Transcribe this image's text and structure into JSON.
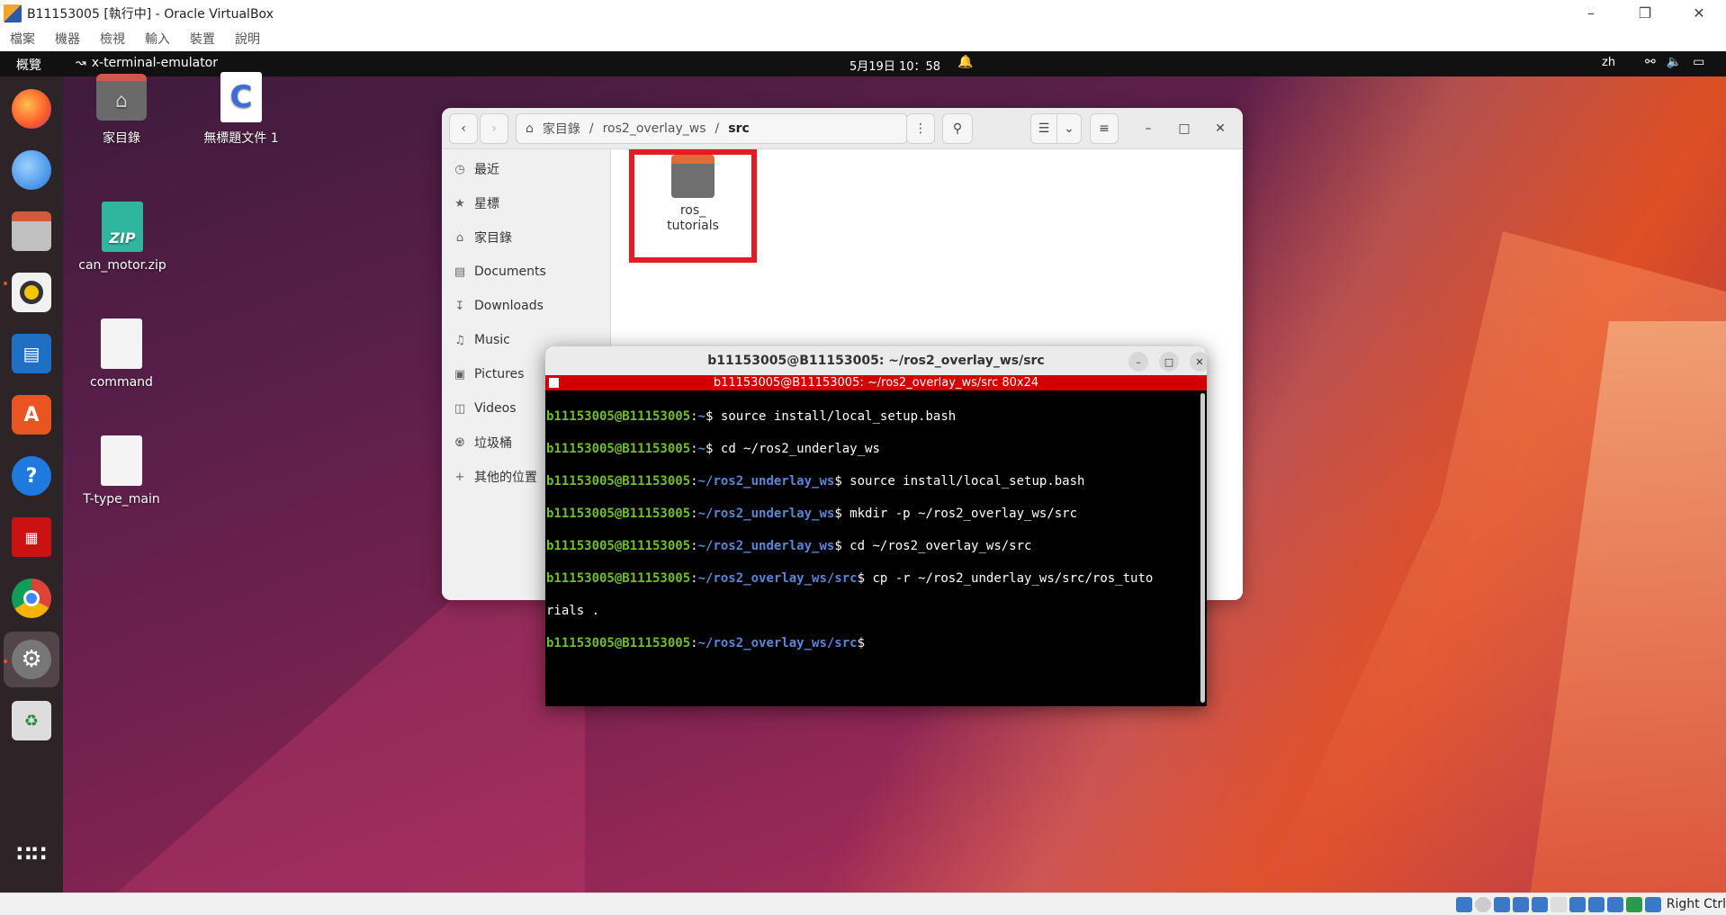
{
  "vbox": {
    "title": "B11153005 [執行中] - Oracle VirtualBox",
    "menu": [
      "檔案",
      "機器",
      "檢視",
      "輸入",
      "裝置",
      "說明"
    ],
    "host_key": "Right Ctrl"
  },
  "topbar": {
    "activities": "概覽",
    "app_name": "x-terminal-emulator",
    "clock": "5月19日 10：58",
    "lang": "zh"
  },
  "desktop": {
    "icons": [
      {
        "label": "家目錄"
      },
      {
        "label": "無標題文件 1"
      },
      {
        "label": "can_motor.zip"
      },
      {
        "label": "command"
      },
      {
        "label": "T-type_main"
      }
    ]
  },
  "files": {
    "path": [
      "家目錄",
      "/",
      "ros2_overlay_ws",
      "/",
      "src"
    ],
    "sidebar": [
      "最近",
      "星標",
      "家目錄",
      "Documents",
      "Downloads",
      "Music",
      "Pictures",
      "Videos",
      "垃圾桶",
      "其他的位置"
    ],
    "folder_line1": "ros_",
    "folder_line2": "tutorials"
  },
  "terminal": {
    "title": "b11153005@B11153005: ~/ros2_overlay_ws/src",
    "bar": "b11153005@B11153005: ~/ros2_overlay_ws/src 80x24",
    "lines": [
      {
        "user": "b11153005@B11153005",
        "path": "~",
        "cmd": "$ source install/local_setup.bash"
      },
      {
        "user": "b11153005@B11153005",
        "path": "~",
        "cmd": "$ cd ~/ros2_underlay_ws"
      },
      {
        "user": "b11153005@B11153005",
        "path": "~/ros2_underlay_ws",
        "cmd": "$ source install/local_setup.bash"
      },
      {
        "user": "b11153005@B11153005",
        "path": "~/ros2_underlay_ws",
        "cmd": "$ mkdir -p ~/ros2_overlay_ws/src"
      },
      {
        "user": "b11153005@B11153005",
        "path": "~/ros2_underlay_ws",
        "cmd": "$ cd ~/ros2_overlay_ws/src"
      },
      {
        "user": "b11153005@B11153005",
        "path": "~/ros2_overlay_ws/src",
        "cmd": "$ cp -r ~/ros2_underlay_ws/src/ros_tuto"
      },
      {
        "user": "",
        "path": "",
        "cmd": "rials ."
      },
      {
        "user": "b11153005@B11153005",
        "path": "~/ros2_overlay_ws/src",
        "cmd": "$"
      }
    ]
  }
}
